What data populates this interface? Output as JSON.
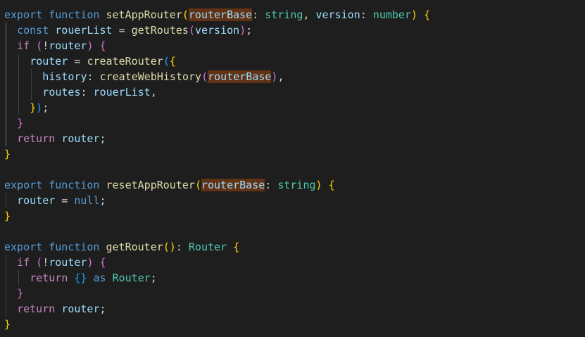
{
  "editor": {
    "background": "#1e1e1e",
    "highlight_color": "#613214",
    "lines": [
      [
        [
          "kw",
          "export"
        ],
        [
          "pun",
          " "
        ],
        [
          "kw",
          "function"
        ],
        [
          "pun",
          " "
        ],
        [
          "fn",
          "setAppRouter"
        ],
        [
          "b1",
          "("
        ],
        [
          "var hl",
          "routerBase"
        ],
        [
          "pun",
          ": "
        ],
        [
          "type",
          "string"
        ],
        [
          "pun",
          ", "
        ],
        [
          "var",
          "version"
        ],
        [
          "pun",
          ": "
        ],
        [
          "type",
          "number"
        ],
        [
          "b1",
          ")"
        ],
        [
          "pun",
          " "
        ],
        [
          "b1",
          "{"
        ]
      ],
      [
        [
          "kw",
          "const"
        ],
        [
          "pun",
          " "
        ],
        [
          "var",
          "rouerList"
        ],
        [
          "pun",
          " = "
        ],
        [
          "fn",
          "getRoutes"
        ],
        [
          "b2",
          "("
        ],
        [
          "var",
          "version"
        ],
        [
          "b2",
          ")"
        ],
        [
          "pun",
          ";"
        ]
      ],
      [
        [
          "ctl",
          "if"
        ],
        [
          "pun",
          " "
        ],
        [
          "b2",
          "("
        ],
        [
          "pun",
          "!"
        ],
        [
          "var",
          "router"
        ],
        [
          "b2",
          ")"
        ],
        [
          "pun",
          " "
        ],
        [
          "b2",
          "{"
        ]
      ],
      [
        [
          "var",
          "router"
        ],
        [
          "pun",
          " = "
        ],
        [
          "fn",
          "createRouter"
        ],
        [
          "b3",
          "("
        ],
        [
          "b1",
          "{"
        ]
      ],
      [
        [
          "var",
          "history"
        ],
        [
          "pun",
          ": "
        ],
        [
          "fn",
          "createWebHistory"
        ],
        [
          "b2",
          "("
        ],
        [
          "var hl",
          "routerBase"
        ],
        [
          "b2",
          ")"
        ],
        [
          "pun",
          ","
        ]
      ],
      [
        [
          "var",
          "routes"
        ],
        [
          "pun",
          ": "
        ],
        [
          "var",
          "rouerList"
        ],
        [
          "pun",
          ","
        ]
      ],
      [
        [
          "b1",
          "}"
        ],
        [
          "b3",
          ")"
        ],
        [
          "pun",
          ";"
        ]
      ],
      [
        [
          "b2",
          "}"
        ]
      ],
      [
        [
          "ctl",
          "return"
        ],
        [
          "pun",
          " "
        ],
        [
          "var",
          "router"
        ],
        [
          "pun",
          ";"
        ]
      ],
      [
        [
          "b1",
          "}"
        ]
      ],
      [],
      [
        [
          "kw",
          "export"
        ],
        [
          "pun",
          " "
        ],
        [
          "kw",
          "function"
        ],
        [
          "pun",
          " "
        ],
        [
          "fn",
          "resetAppRouter"
        ],
        [
          "b1",
          "("
        ],
        [
          "var hl",
          "routerBase"
        ],
        [
          "pun",
          ": "
        ],
        [
          "type",
          "string"
        ],
        [
          "b1",
          ")"
        ],
        [
          "pun",
          " "
        ],
        [
          "b1",
          "{"
        ]
      ],
      [
        [
          "var",
          "router"
        ],
        [
          "pun",
          " = "
        ],
        [
          "kw",
          "null"
        ],
        [
          "pun",
          ";"
        ]
      ],
      [
        [
          "b1",
          "}"
        ]
      ],
      [],
      [
        [
          "kw",
          "export"
        ],
        [
          "pun",
          " "
        ],
        [
          "kw",
          "function"
        ],
        [
          "pun",
          " "
        ],
        [
          "fn",
          "getRouter"
        ],
        [
          "b1",
          "()"
        ],
        [
          "pun",
          ": "
        ],
        [
          "type",
          "Router"
        ],
        [
          "pun",
          " "
        ],
        [
          "b1",
          "{"
        ]
      ],
      [
        [
          "ctl",
          "if"
        ],
        [
          "pun",
          " "
        ],
        [
          "b2",
          "("
        ],
        [
          "pun",
          "!"
        ],
        [
          "var",
          "router"
        ],
        [
          "b2",
          ")"
        ],
        [
          "pun",
          " "
        ],
        [
          "b2",
          "{"
        ]
      ],
      [
        [
          "ctl",
          "return"
        ],
        [
          "pun",
          " "
        ],
        [
          "b3",
          "{}"
        ],
        [
          "pun",
          " "
        ],
        [
          "kw",
          "as"
        ],
        [
          "pun",
          " "
        ],
        [
          "type",
          "Router"
        ],
        [
          "pun",
          ";"
        ]
      ],
      [
        [
          "b2",
          "}"
        ]
      ],
      [
        [
          "ctl",
          "return"
        ],
        [
          "pun",
          " "
        ],
        [
          "var",
          "router"
        ],
        [
          "pun",
          ";"
        ]
      ],
      [
        [
          "b1",
          "}"
        ]
      ]
    ]
  }
}
